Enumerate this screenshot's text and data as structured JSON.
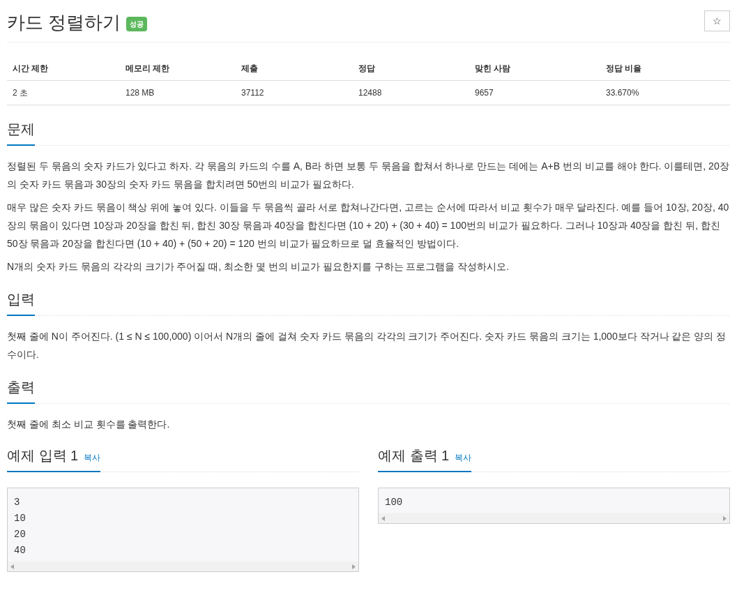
{
  "title": "카드 정렬하기",
  "badge": "성공",
  "star_button": "☆",
  "stats": {
    "columns": [
      "시간 제한",
      "메모리 제한",
      "제출",
      "정답",
      "맞힌 사람",
      "정답 비율"
    ],
    "row": [
      "2 초",
      "128 MB",
      "37112",
      "12488",
      "9657",
      "33.670%"
    ]
  },
  "sections": [
    {
      "heading": "문제",
      "paragraphs": [
        "정렬된 두 묶음의 숫자 카드가 있다고 하자. 각 묶음의 카드의 수를 A, B라 하면 보통 두 묶음을 합쳐서 하나로 만드는 데에는 A+B 번의 비교를 해야 한다. 이를테면, 20장의 숫자 카드 묶음과 30장의 숫자 카드 묶음을 합치려면 50번의 비교가 필요하다.",
        "매우 많은 숫자 카드 묶음이 책상 위에 놓여 있다. 이들을 두 묶음씩 골라 서로 합쳐나간다면, 고르는 순서에 따라서 비교 횟수가 매우 달라진다. 예를 들어 10장, 20장, 40장의 묶음이 있다면 10장과 20장을 합친 뒤, 합친 30장 묶음과 40장을 합친다면 (10 + 20) + (30 + 40) = 100번의 비교가 필요하다. 그러나 10장과 40장을 합친 뒤, 합친 50장 묶음과 20장을 합친다면 (10 + 40) + (50 + 20) = 120 번의 비교가 필요하므로 덜 효율적인 방법이다.",
        "N개의 숫자 카드 묶음의 각각의 크기가 주어질 때, 최소한 몇 번의 비교가 필요한지를 구하는 프로그램을 작성하시오."
      ]
    },
    {
      "heading": "입력",
      "paragraphs": [
        "첫째 줄에 N이 주어진다. (1 ≤ N ≤ 100,000) 이어서 N개의 줄에 걸쳐 숫자 카드 묶음의 각각의 크기가 주어진다. 숫자 카드 묶음의 크기는 1,000보다 작거나 같은 양의 정수이다."
      ]
    },
    {
      "heading": "출력",
      "paragraphs": [
        "첫째 줄에 최소 비교 횟수를 출력한다."
      ]
    }
  ],
  "samples": [
    {
      "heading": "예제 입력 1",
      "copy": "복사",
      "lines": [
        "3",
        "10",
        "20",
        "40"
      ]
    },
    {
      "heading": "예제 출력 1",
      "copy": "복사",
      "lines": [
        "100"
      ]
    }
  ]
}
